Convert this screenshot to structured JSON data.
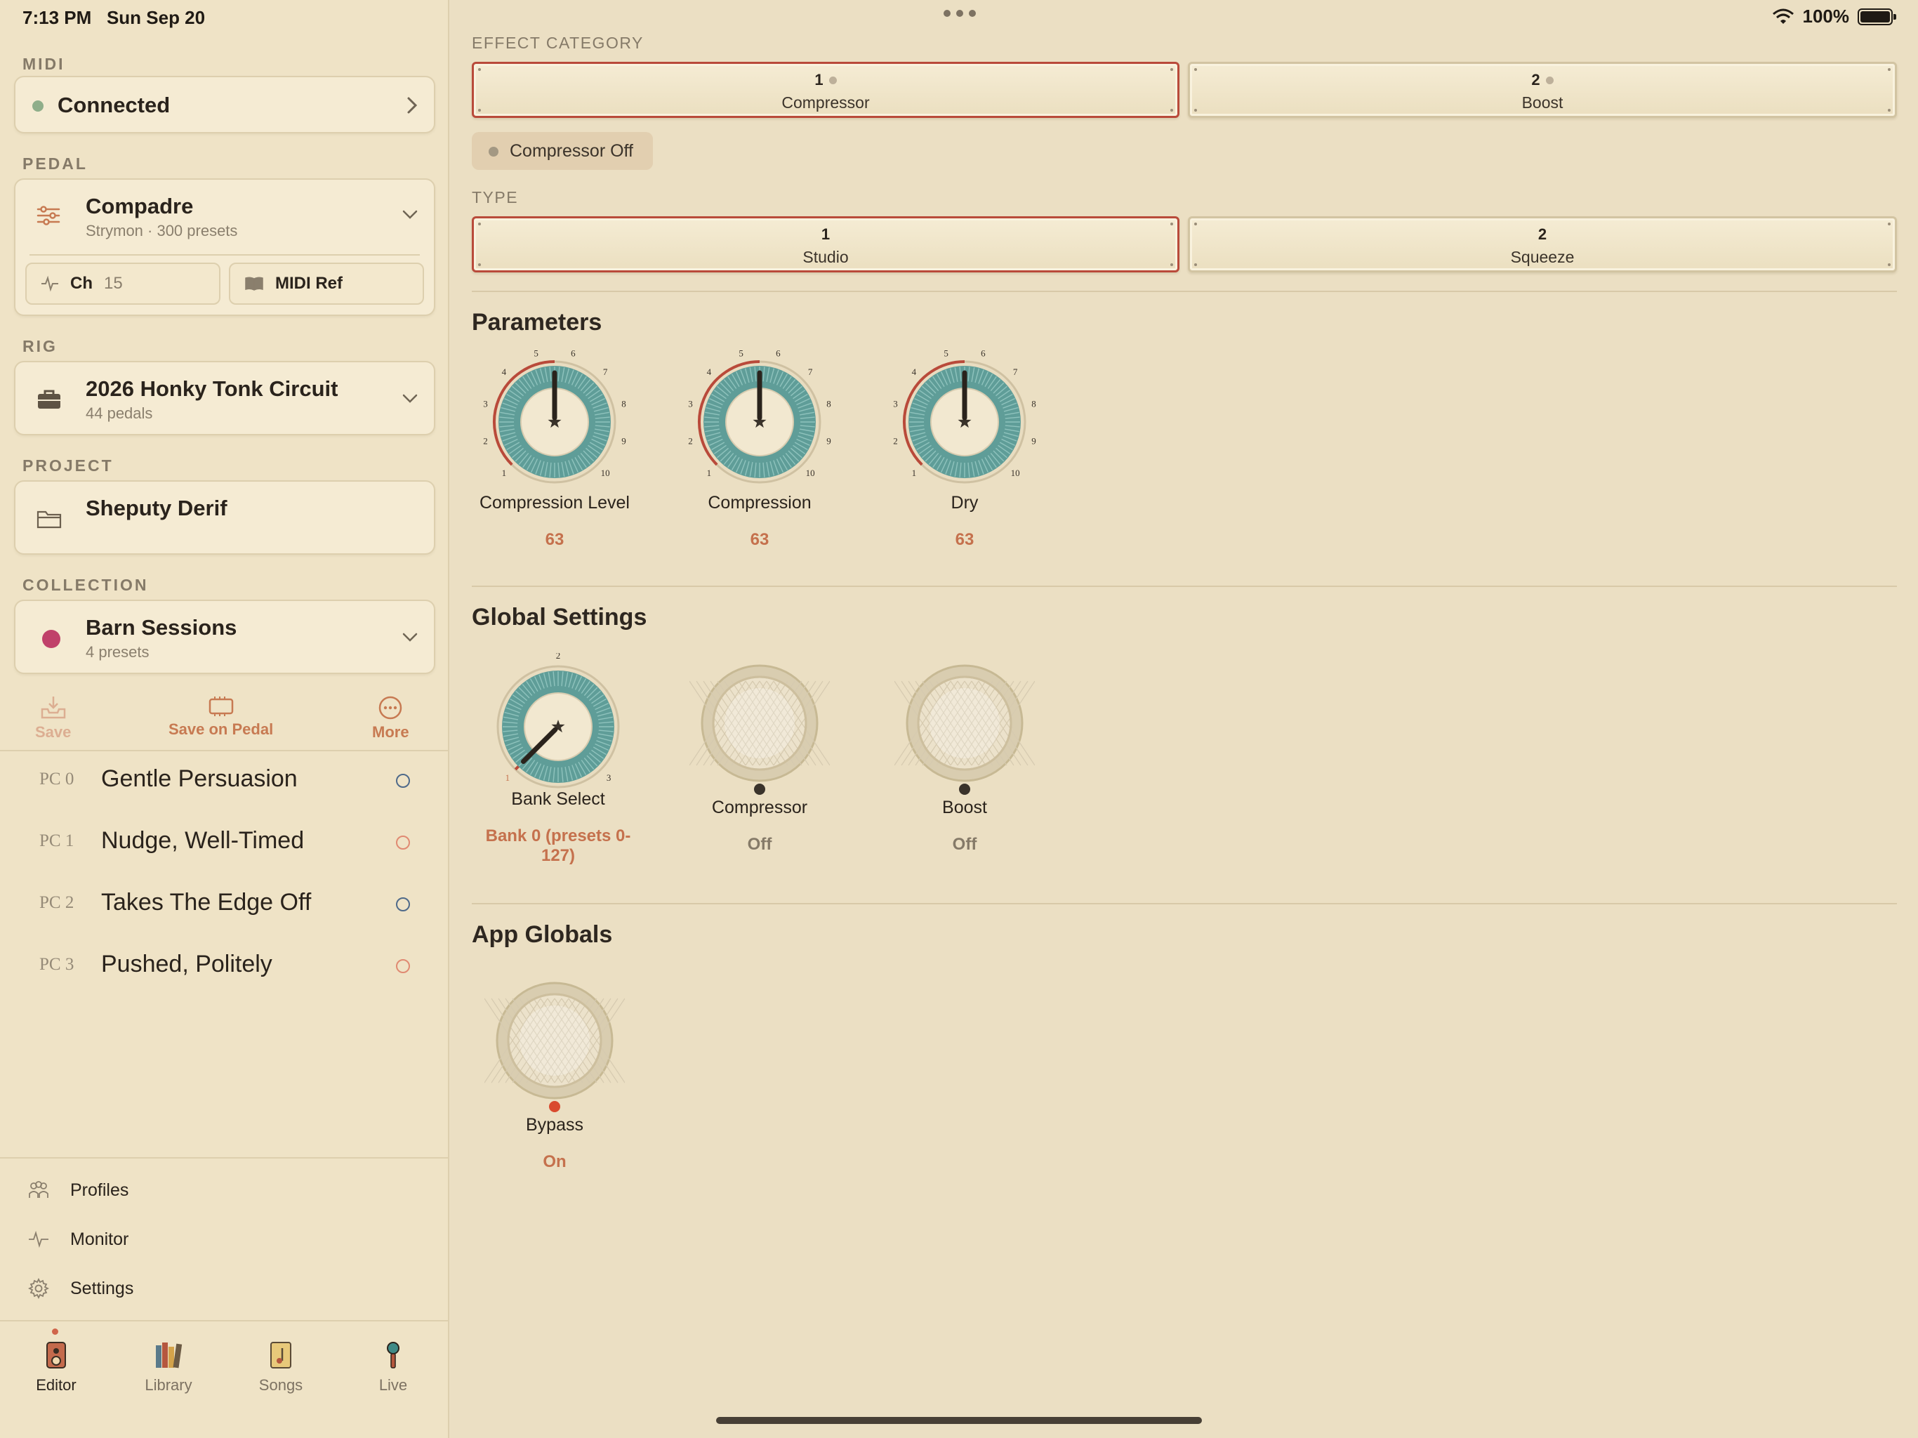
{
  "status": {
    "time": "7:13 PM",
    "date": "Sun Sep 20",
    "battery": "100%"
  },
  "sidebar": {
    "midi": {
      "label": "MIDI",
      "status": "Connected"
    },
    "pedal": {
      "label": "PEDAL",
      "name": "Compadre",
      "sub": "Strymon · 300 presets",
      "channel_label": "Ch",
      "channel_value": "15",
      "midi_ref": "MIDI Ref"
    },
    "rig": {
      "label": "RIG",
      "name": "2026 Honky Tonk Circuit",
      "sub": "44 pedals"
    },
    "project": {
      "label": "PROJECT",
      "name": "Sheputy Derif"
    },
    "collection": {
      "label": "COLLECTION",
      "name": "Barn Sessions",
      "sub": "4 presets",
      "color": "#c0416a"
    },
    "actions": {
      "save": "Save",
      "save_on_pedal": "Save on Pedal",
      "more": "More"
    },
    "presets": [
      {
        "pc": "PC 0",
        "name": "Gentle Persuasion",
        "ring_color": "#4f6a8a"
      },
      {
        "pc": "PC 1",
        "name": "Nudge, Well-Timed",
        "ring_color": "#e08a72"
      },
      {
        "pc": "PC 2",
        "name": "Takes The Edge Off",
        "ring_color": "#4f6a8a"
      },
      {
        "pc": "PC 3",
        "name": "Pushed, Politely",
        "ring_color": "#e08a72"
      }
    ],
    "nav": {
      "profiles": "Profiles",
      "monitor": "Monitor",
      "settings": "Settings"
    },
    "tabs": {
      "editor": "Editor",
      "library": "Library",
      "songs": "Songs",
      "live": "Live"
    }
  },
  "main": {
    "effect_category": {
      "label": "EFFECT CATEGORY",
      "options": [
        {
          "num": "1",
          "label": "Compressor",
          "selected": true
        },
        {
          "num": "2",
          "label": "Boost",
          "selected": false
        }
      ]
    },
    "effect_status": "Compressor Off",
    "type": {
      "label": "TYPE",
      "options": [
        {
          "num": "1",
          "label": "Studio",
          "selected": true
        },
        {
          "num": "2",
          "label": "Squeeze",
          "selected": false
        }
      ]
    },
    "parameters": {
      "title": "Parameters",
      "knob_scale": [
        "1",
        "2",
        "3",
        "4",
        "5",
        "6",
        "7",
        "8",
        "9",
        "10"
      ],
      "knobs": [
        {
          "name": "Compression Level",
          "value": "63",
          "level": 0.5
        },
        {
          "name": "Compression",
          "value": "63",
          "level": 0.5
        },
        {
          "name": "Dry",
          "value": "63",
          "level": 0.5
        }
      ]
    },
    "global_settings": {
      "title": "Global Settings",
      "bank_select": {
        "name": "Bank Select",
        "value": "Bank 0 (presets 0-127)",
        "scale": [
          "1",
          "2",
          "3"
        ],
        "level": 0.0
      },
      "switches": [
        {
          "name": "Compressor",
          "value": "Off",
          "led": "#3a332b"
        },
        {
          "name": "Boost",
          "value": "Off",
          "led": "#3a332b"
        }
      ]
    },
    "app_globals": {
      "title": "App Globals",
      "bypass": {
        "name": "Bypass",
        "value": "On",
        "led": "#d94a2e"
      }
    }
  },
  "colors": {
    "accent": "#c5714d",
    "selected_border": "#b94a3a",
    "knob_teal": "#5f9d98",
    "background": "#ebdfc3"
  }
}
